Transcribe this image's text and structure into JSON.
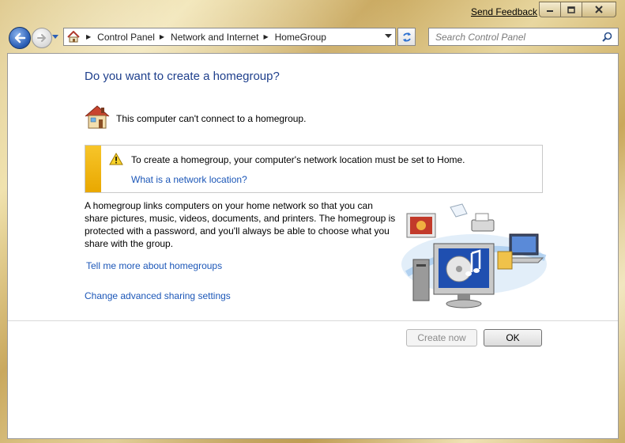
{
  "window": {
    "send_feedback": "Send Feedback"
  },
  "nav": {
    "breadcrumbs": [
      "Control Panel",
      "Network and Internet",
      "HomeGroup"
    ],
    "search_placeholder": "Search Control Panel"
  },
  "main": {
    "title": "Do you want to create a homegroup?",
    "status_text": "This computer can't connect to a homegroup.",
    "warning": {
      "text": "To create a homegroup, your computer's network location must be set to Home.",
      "link": "What is a network location?"
    },
    "description": "A homegroup links computers on your home network so that you can share pictures, music, videos, documents, and printers. The homegroup is protected with a password, and you'll always be able to choose what you share with the group.",
    "link_more": "Tell me more about homegroups",
    "link_advanced": "Change advanced sharing settings"
  },
  "buttons": {
    "create_now": "Create now",
    "ok": "OK"
  },
  "colors": {
    "title_blue": "#1e3f8c",
    "link_blue": "#1c57b8",
    "warning_yellow": "#f2b81a"
  },
  "icons": [
    "back-arrow-icon",
    "forward-arrow-icon",
    "house-icon",
    "refresh-icon",
    "search-icon",
    "homegroup-icon",
    "warning-icon",
    "homegroup-illustration"
  ]
}
